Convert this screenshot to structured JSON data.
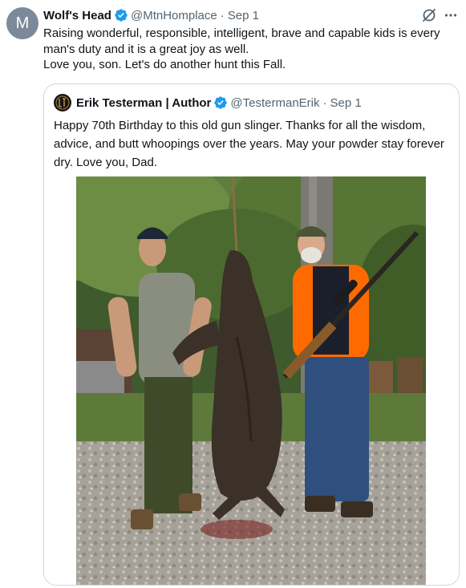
{
  "tweet": {
    "avatar_letter": "M",
    "author_name": "Wolf's Head",
    "handle": "@MtnHomplace",
    "separator": "·",
    "date": "Sep 1",
    "text_lines": [
      "Raising wonderful, responsible, intelligent, brave and capable kids is every man's duty and it is a great joy as well.",
      "Love you, son. Let's do another hunt this Fall."
    ],
    "icons": {
      "grok": "grok-icon",
      "more": "more-icon",
      "verified": "verified-badge-icon"
    }
  },
  "quoted_tweet": {
    "author_name": "Erik Testerman | Author",
    "handle": "@TestermanErik",
    "separator": "·",
    "date": "Sep 1",
    "text": "Happy 70th Birthday to this old gun slinger. Thanks for all the wisdom, advice, and butt whoopings over the years. May your powder stay forever dry. Love you, Dad.",
    "avatar_icon": "author-logo-icon",
    "media": {
      "type": "photo",
      "subject": "hunting-photo"
    }
  },
  "colors": {
    "text_primary": "#0f1419",
    "text_secondary": "#536471",
    "verified_blue": "#1d9bf0",
    "border": "#cfd9de"
  }
}
